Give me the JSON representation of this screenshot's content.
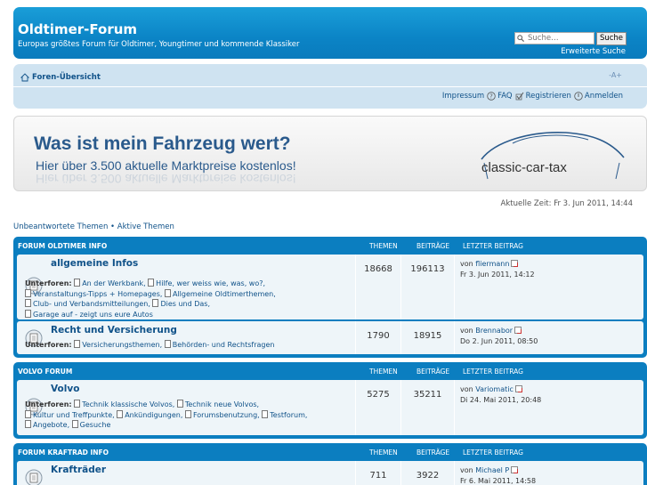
{
  "header": {
    "title": "Oldtimer-Forum",
    "description": "Europas größtes Forum für Oldtimer, Youngtimer und kommende Klassiker",
    "search_placeholder": "Suche…",
    "search_button": "Suche",
    "advanced_search": "Erweiterte Suche"
  },
  "navbar": {
    "forum_index": "Foren-Übersicht",
    "font_size": "-A+",
    "links": {
      "impressum": "Impressum",
      "faq": "FAQ",
      "register": "Registrieren",
      "login": "Anmelden"
    }
  },
  "banner": {
    "headline": "Was ist mein Fahrzeug wert?",
    "subline": "Hier über 3.500 aktuelle Marktpreise kostenlos!",
    "logo": "classic-car-tax"
  },
  "current_time": "Aktuelle Zeit: Fr 3. Jun 2011, 14:44",
  "quick_links": {
    "unanswered": "Unbeantwortete Themen",
    "separator": "•",
    "active": "Aktive Themen"
  },
  "columns": {
    "topics": "Themen",
    "posts": "Beiträge",
    "last_post": "Letzter Beitrag"
  },
  "subforums_label": "Unterforen:",
  "by": "von",
  "categories": [
    {
      "title": "Forum Oldtimer Info",
      "forums": [
        {
          "title": "allgemeine Infos",
          "topics": "18668",
          "posts": "196113",
          "last_author": "fliermann",
          "last_date": "Fr 3. Jun 2011, 14:12",
          "subforums": [
            "An der Werkbank,",
            "Hilfe, wer weiss wie, was, wo?,",
            "Veranstaltungs-Tipps + Homepages,",
            "Allgemeine Oldtimerthemen,",
            "Club- und Verbandsmitteilungen,",
            "Dies und Das,",
            "Garage auf - zeigt uns eure Autos"
          ]
        },
        {
          "title": "Recht und Versicherung",
          "topics": "1790",
          "posts": "18915",
          "last_author": "Brennabor",
          "last_date": "Do 2. Jun 2011, 08:50",
          "subforums": [
            "Versicherungsthemen,",
            "Behörden- und Rechtsfragen"
          ]
        }
      ]
    },
    {
      "title": "Volvo Forum",
      "forums": [
        {
          "title": "Volvo",
          "topics": "5275",
          "posts": "35211",
          "last_author": "Variomatic",
          "last_date": "Di 24. Mai 2011, 20:48",
          "subforums": [
            "Technik klassische Volvos,",
            "Technik neue Volvos,",
            "Kultur und Treffpunkte,",
            "Ankündigungen,",
            "Forumsbenutzung,",
            "Testforum,",
            "Angebote,",
            "Gesuche"
          ]
        }
      ]
    },
    {
      "title": "Forum Kraftrad Info",
      "forums": [
        {
          "title": "Krafträder",
          "topics": "711",
          "posts": "3922",
          "last_author": "Michael P",
          "last_date": "Fr 6. Mai 2011, 14:58",
          "subforums": []
        }
      ]
    }
  ]
}
